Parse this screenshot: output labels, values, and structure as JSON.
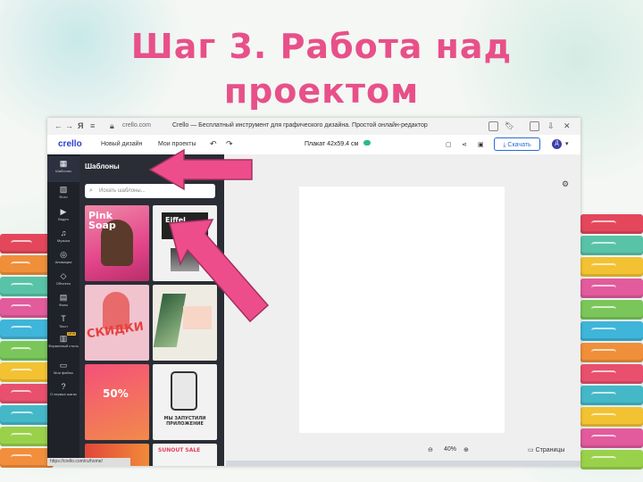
{
  "slide": {
    "title_line1": "Шаг 3. Работа над",
    "title_line2": "проектом"
  },
  "browser": {
    "address": "crello.com",
    "page_title": "Crello — Бесплатный инструмент для графического дизайна. Простой онлайн-редактор",
    "status_url": "https://crello.com/ru/home/"
  },
  "app": {
    "logo": "crello",
    "nav": [
      "Новый дизайн",
      "Мои проекты"
    ],
    "doc_size": "Плакат 42x59.4 см",
    "download_label": "Скачать",
    "avatar_initial": "Д",
    "accent_color": "#2a6bd1"
  },
  "sidebar": {
    "items": [
      {
        "label": "Шаблоны",
        "icon": "grid-icon"
      },
      {
        "label": "Фото",
        "icon": "photo-icon"
      },
      {
        "label": "Видео",
        "icon": "video-icon"
      },
      {
        "label": "Музыка",
        "icon": "music-icon"
      },
      {
        "label": "Анимация",
        "icon": "animation-icon"
      },
      {
        "label": "Объекты",
        "icon": "objects-icon"
      },
      {
        "label": "Фоны",
        "icon": "backgrounds-icon"
      },
      {
        "label": "Текст",
        "icon": "text-icon"
      },
      {
        "label": "Фирменный стиль",
        "icon": "brand-icon",
        "badge": "NEW"
      },
      {
        "label": "Мои файлы",
        "icon": "folder-icon"
      },
      {
        "label": "О первых шагах",
        "icon": "help-icon"
      }
    ]
  },
  "panel": {
    "title": "Шаблоны",
    "search_placeholder": "Искать шаблоны...",
    "templates": [
      {
        "text": "Pink Soap",
        "bg": "#e8578f"
      },
      {
        "text": "Eiffel",
        "bg": "#f1f1f1"
      },
      {
        "text": "СКИДКИ",
        "bg": "#f0c3cf"
      },
      {
        "text": "",
        "bg": "#eeebe2"
      },
      {
        "text": "50%",
        "bg": "#ef5b5b"
      },
      {
        "text": "МЫ ЗАПУСТИЛИ ПРИЛОЖЕНИЕ",
        "bg": "#f2f2f2"
      },
      {
        "text": "",
        "bg": "#e0473a"
      },
      {
        "text": "SUNOUT SALE",
        "bg": "#f4f4f4"
      }
    ]
  },
  "canvas": {
    "zoom": "40%",
    "pages_label": "Страницы"
  }
}
